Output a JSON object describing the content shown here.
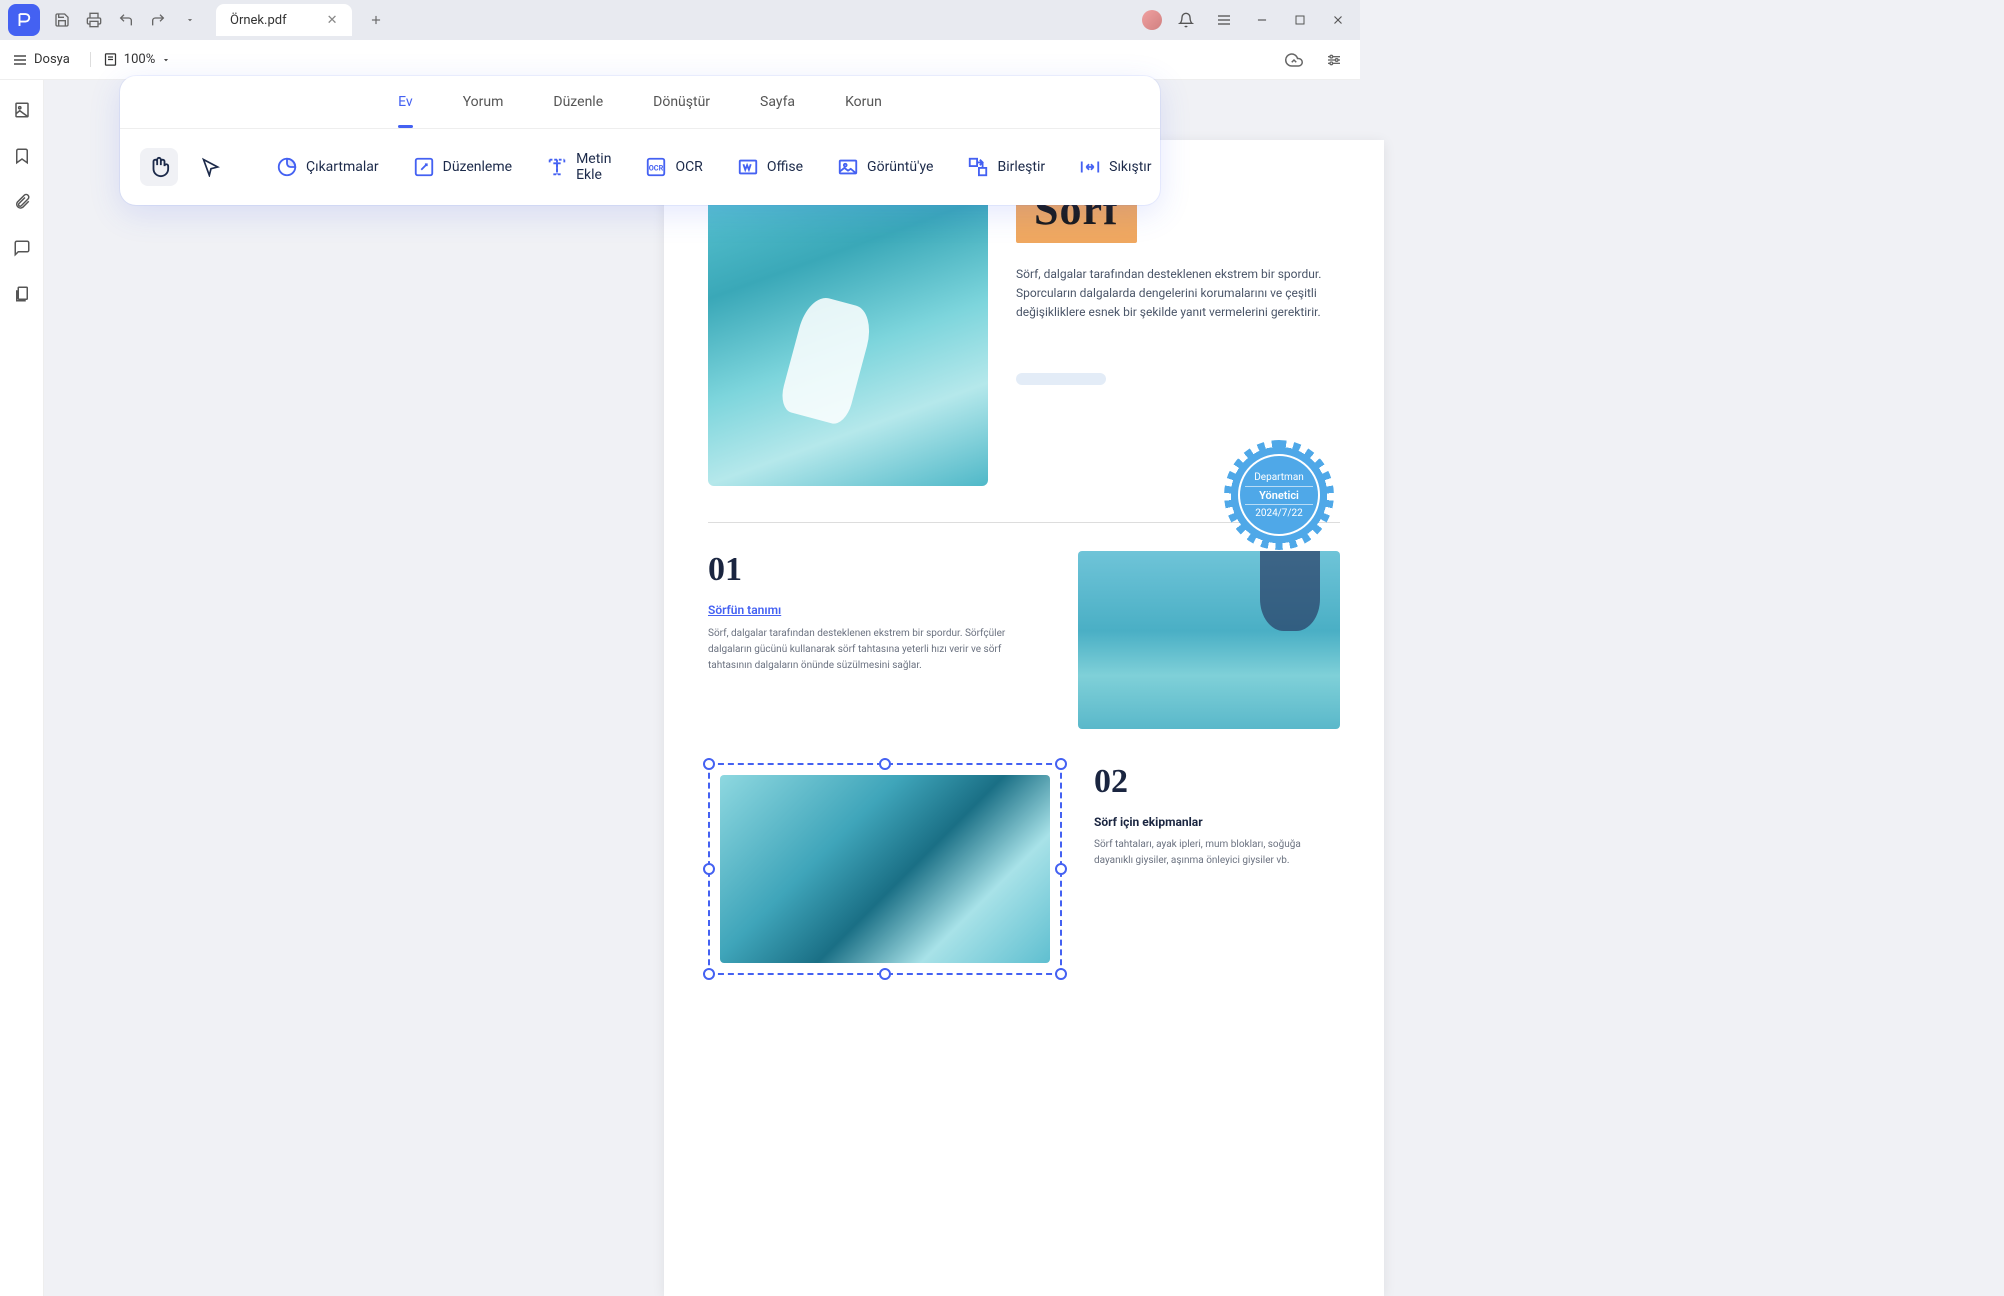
{
  "titlebar": {
    "tab_name": "Örnek.pdf"
  },
  "menu": {
    "file_label": "Dosya",
    "zoom": "100%"
  },
  "panel": {
    "tabs": {
      "home": "Ev",
      "comment": "Yorum",
      "edit": "Düzenle",
      "convert": "Dönüştür",
      "page": "Sayfa",
      "protect": "Korun"
    },
    "tools": {
      "stickers": "Çıkartmalar",
      "editing": "Düzenleme",
      "add_text": "Metin Ekle",
      "ocr": "OCR",
      "office": "Offise",
      "to_image": "Görüntü'ye",
      "merge": "Birleştir",
      "compress": "Sıkıştır"
    }
  },
  "doc": {
    "hero_title": "Sörf",
    "hero_text": "Sörf, dalgalar tarafından desteklenen ekstrem bir spordur. Sporcuların dalgalarda dengelerini korumalarını ve çeşitli değişikliklere esnek bir şekilde yanıt vermelerini gerektirir.",
    "stamp": {
      "top": "Departman",
      "mid": "Yönetici",
      "bottom": "2024/7/22"
    },
    "sec1": {
      "num": "01",
      "link": "Sörfün tanımı",
      "body": "Sörf, dalgalar tarafından desteklenen ekstrem bir spordur. Sörfçüler dalgaların gücünü kullanarak sörf tahtasına yeterli hızı verir ve sörf tahtasının dalgaların önünde süzülmesini sağlar."
    },
    "sec2": {
      "num": "02",
      "subtitle": "Sörf için ekipmanlar",
      "body": "Sörf tahtaları, ayak ipleri, mum blokları, soğuğa dayanıklı giysiler, aşınma önleyici giysiler vb."
    }
  }
}
